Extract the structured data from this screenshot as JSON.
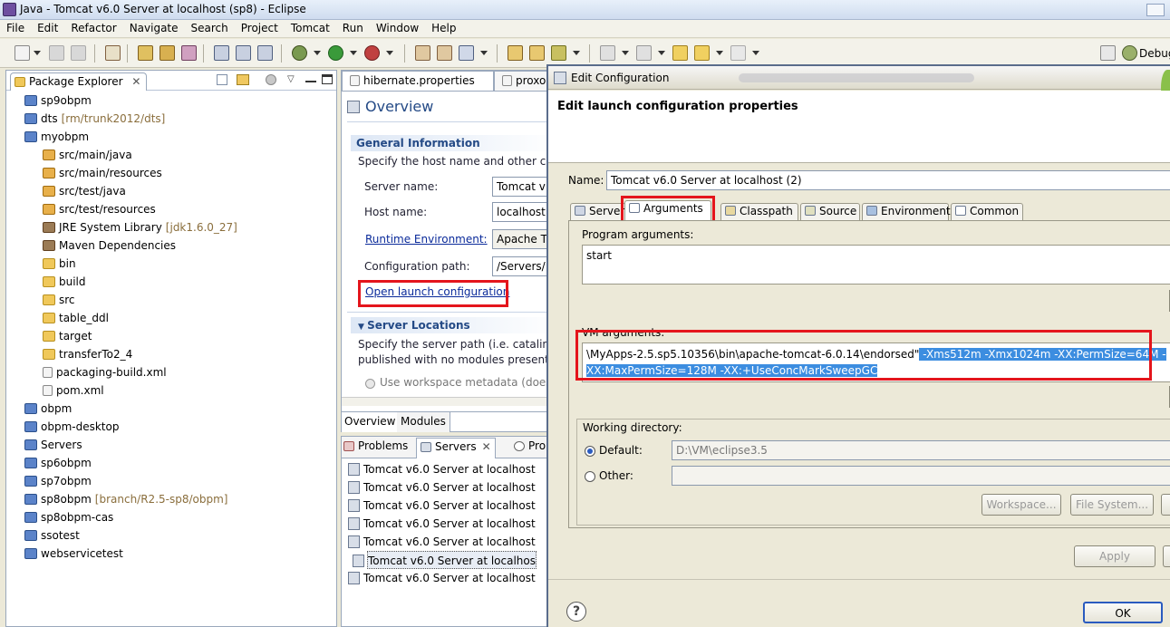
{
  "window": {
    "title": "Java - Tomcat v6.0 Server at localhost (sp8) - Eclipse"
  },
  "menu": [
    "File",
    "Edit",
    "Refactor",
    "Navigate",
    "Search",
    "Project",
    "Tomcat",
    "Run",
    "Window",
    "Help"
  ],
  "toolbar": {
    "perspective_label": "Debug"
  },
  "package_explorer": {
    "title": "Package Explorer",
    "items": [
      {
        "label": "sp9obpm",
        "suffix": "",
        "icon": "project-icon",
        "level": 1
      },
      {
        "label": "dts",
        "suffix": "[rm/trunk2012/dts]",
        "icon": "project-icon",
        "level": 1
      },
      {
        "label": "myobpm",
        "suffix": "",
        "icon": "maven-project-icon",
        "level": 1
      },
      {
        "label": "src/main/java",
        "suffix": "",
        "icon": "source-folder-icon",
        "level": 2
      },
      {
        "label": "src/main/resources",
        "suffix": "",
        "icon": "source-folder-icon",
        "level": 2
      },
      {
        "label": "src/test/java",
        "suffix": "",
        "icon": "source-folder-icon",
        "level": 2
      },
      {
        "label": "src/test/resources",
        "suffix": "",
        "icon": "source-folder-icon",
        "level": 2
      },
      {
        "label": "JRE System Library",
        "suffix": "[jdk1.6.0_27]",
        "icon": "library-icon",
        "level": 2
      },
      {
        "label": "Maven Dependencies",
        "suffix": "",
        "icon": "library-icon",
        "level": 2
      },
      {
        "label": "bin",
        "suffix": "",
        "icon": "folder-icon",
        "level": 2
      },
      {
        "label": "build",
        "suffix": "",
        "icon": "folder-icon",
        "level": 2
      },
      {
        "label": "src",
        "suffix": "",
        "icon": "folder-icon",
        "level": 2
      },
      {
        "label": "table_ddl",
        "suffix": "",
        "icon": "folder-icon",
        "level": 2
      },
      {
        "label": "target",
        "suffix": "",
        "icon": "folder-icon",
        "level": 2
      },
      {
        "label": "transferTo2_4",
        "suffix": "",
        "icon": "folder-icon",
        "level": 2
      },
      {
        "label": "packaging-build.xml",
        "suffix": "",
        "icon": "xml-file-icon",
        "level": 2
      },
      {
        "label": "pom.xml",
        "suffix": "",
        "icon": "pom-file-icon",
        "level": 2
      },
      {
        "label": "obpm",
        "suffix": "",
        "icon": "project-icon",
        "level": 1
      },
      {
        "label": "obpm-desktop",
        "suffix": "",
        "icon": "project-icon",
        "level": 1
      },
      {
        "label": "Servers",
        "suffix": "",
        "icon": "project-icon",
        "level": 1
      },
      {
        "label": "sp6obpm",
        "suffix": "",
        "icon": "project-icon",
        "level": 1
      },
      {
        "label": "sp7obpm",
        "suffix": "",
        "icon": "project-icon",
        "level": 1
      },
      {
        "label": "sp8obpm",
        "suffix": "[branch/R2.5-sp8/obpm]",
        "icon": "maven-project-icon",
        "level": 1
      },
      {
        "label": "sp8obpm-cas",
        "suffix": "",
        "icon": "project-icon",
        "level": 1
      },
      {
        "label": "ssotest",
        "suffix": "",
        "icon": "project-icon",
        "level": 1
      },
      {
        "label": "webservicetest",
        "suffix": "",
        "icon": "project-icon",
        "level": 1
      }
    ]
  },
  "editor": {
    "tabs": [
      "hibernate.properties",
      "proxo"
    ],
    "overview_title": "Overview",
    "general_info_title": "General Information",
    "general_info_desc": "Specify the host name and other co",
    "server_name_label": "Server name:",
    "server_name_value": "Tomcat v",
    "host_name_label": "Host name:",
    "host_name_value": "localhost",
    "runtime_label": "Runtime Environment:",
    "runtime_value": "Apache T",
    "config_path_label": "Configuration path:",
    "config_path_value": "/Servers/",
    "open_launch_link": "Open launch configuration",
    "server_locations_title": "Server Locations",
    "server_locations_desc1": "Specify the server path (i.e. catalina.",
    "server_locations_desc2": "published with no modules present",
    "use_workspace_label": "Use workspace metadata (does",
    "bottom_tabs": [
      "Overview",
      "Modules"
    ]
  },
  "servers_view": {
    "tabs": [
      "Problems",
      "Servers",
      "Pro"
    ],
    "items": [
      "Tomcat v6.0 Server at localhost",
      "Tomcat v6.0 Server at localhost",
      "Tomcat v6.0 Server at localhost",
      "Tomcat v6.0 Server at localhost",
      "Tomcat v6.0 Server at localhost",
      "Tomcat v6.0 Server at localhos",
      "Tomcat v6.0 Server at localhost"
    ]
  },
  "dialog": {
    "title": "Edit Configuration",
    "header": "Edit launch configuration properties",
    "name_label": "Name:",
    "name_value": "Tomcat v6.0 Server at localhost (2)",
    "tabs": [
      "Server",
      "Arguments",
      "Classpath",
      "Source",
      "Environment",
      "Common"
    ],
    "program_args_label": "Program arguments:",
    "program_args_value": "start",
    "vm_args_label": "VM arguments:",
    "vm_args_line1_plain": "\\MyApps-2.5.sp5.10356\\bin\\apache-tomcat-6.0.14\\endorsed\"",
    "vm_args_line1_selected": " -Xms512m -Xmx1024m -XX:PermSize=64M -",
    "vm_args_line2_selected": "XX:MaxPermSize=128M -XX:+UseConcMarkSweepGC",
    "working_dir_label": "Working directory:",
    "default_label": "Default:",
    "default_value": "D:\\VM\\eclipse3.5",
    "other_label": "Other:",
    "workspace_button": "Workspace...",
    "filesystem_button": "File System...",
    "apply_button": "Apply",
    "ok_button": "OK",
    "help_icon": "?"
  }
}
